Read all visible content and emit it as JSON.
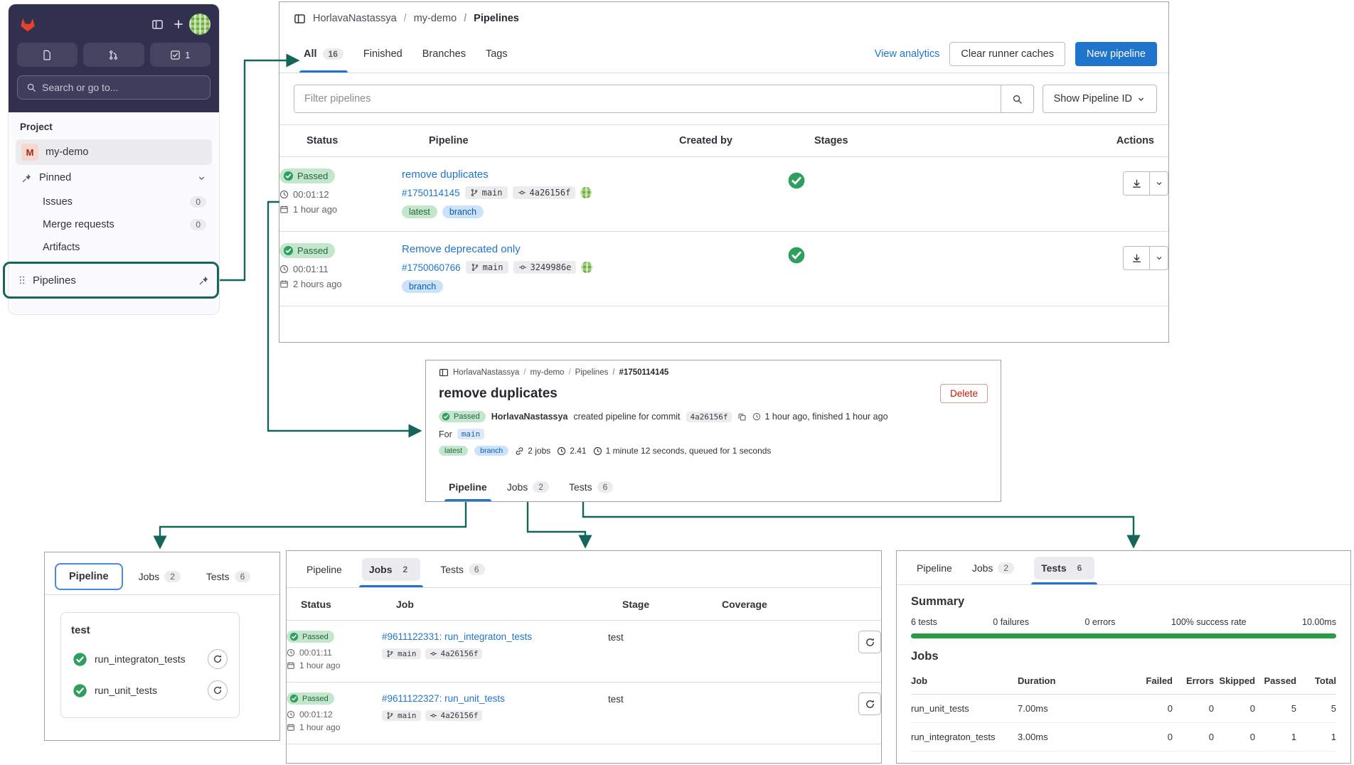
{
  "colors": {
    "accent_blue": "#1f75cb",
    "success_green": "#2f9e5e",
    "annotation_teal": "#14665a",
    "danger_red": "#c91c00"
  },
  "sidebar": {
    "todo_count": "1",
    "search_placeholder": "Search or go to...",
    "section_label": "Project",
    "project_initial": "M",
    "project_name": "my-demo",
    "pinned_label": "Pinned",
    "items": [
      {
        "label": "Issues",
        "count": "0"
      },
      {
        "label": "Merge requests",
        "count": "0"
      },
      {
        "label": "Artifacts"
      }
    ],
    "pipelines_label": "Pipelines"
  },
  "pipelines_panel": {
    "breadcrumb": {
      "group": "HorlavaNastassya",
      "project": "my-demo",
      "page": "Pipelines"
    },
    "tabs": [
      {
        "label": "All",
        "count": "16"
      },
      {
        "label": "Finished"
      },
      {
        "label": "Branches"
      },
      {
        "label": "Tags"
      }
    ],
    "view_analytics_label": "View analytics",
    "clear_caches_label": "Clear runner caches",
    "new_pipeline_label": "New pipeline",
    "filter_placeholder": "Filter pipelines",
    "show_pipeline_id_label": "Show Pipeline ID",
    "columns": {
      "status": "Status",
      "pipeline": "Pipeline",
      "created_by": "Created by",
      "stages": "Stages",
      "actions": "Actions"
    },
    "rows": [
      {
        "status": "Passed",
        "duration": "00:01:12",
        "age": "1 hour ago",
        "title": "remove duplicates",
        "id": "#1750114145",
        "branch": "main",
        "commit": "4a26156f",
        "tag1": "latest",
        "tag2": "branch"
      },
      {
        "status": "Passed",
        "duration": "00:01:11",
        "age": "2 hours ago",
        "title": "Remove deprecated only",
        "id": "#1750060766",
        "branch": "main",
        "commit": "3249986e",
        "tag1": "branch"
      }
    ]
  },
  "detail_panel": {
    "breadcrumb": {
      "group": "HorlavaNastassya",
      "project": "my-demo",
      "page": "Pipelines",
      "id": "#1750114145"
    },
    "title": "remove duplicates",
    "delete_label": "Delete",
    "status": "Passed",
    "user": "HorlavaNastassya",
    "action_text": "created pipeline for commit",
    "commit": "4a26156f",
    "time_text": "1 hour ago, finished 1 hour ago",
    "for_label": "For",
    "branch": "main",
    "tag1": "latest",
    "tag2": "branch",
    "jobs_label": "2 jobs",
    "compute": "2.41",
    "duration_text": "1 minute 12 seconds, queued for 1 seconds",
    "tabs": {
      "pipeline": "Pipeline",
      "jobs": "Jobs",
      "jobs_count": "2",
      "tests": "Tests",
      "tests_count": "6"
    }
  },
  "graph_panel": {
    "tabs": {
      "pipeline": "Pipeline",
      "jobs": "Jobs",
      "jobs_count": "2",
      "tests": "Tests",
      "tests_count": "6"
    },
    "stage_name": "test",
    "jobs": [
      {
        "name": "run_integraton_tests"
      },
      {
        "name": "run_unit_tests"
      }
    ]
  },
  "jobs_panel": {
    "tabs": {
      "pipeline": "Pipeline",
      "jobs": "Jobs",
      "jobs_count": "2",
      "tests": "Tests",
      "tests_count": "6"
    },
    "columns": {
      "status": "Status",
      "job": "Job",
      "stage": "Stage",
      "coverage": "Coverage"
    },
    "rows": [
      {
        "status": "Passed",
        "duration": "00:01:11",
        "age": "1 hour ago",
        "job": "#9611122331: run_integraton_tests",
        "branch": "main",
        "commit": "4a26156f",
        "stage": "test"
      },
      {
        "status": "Passed",
        "duration": "00:01:12",
        "age": "1 hour ago",
        "job": "#9611122327: run_unit_tests",
        "branch": "main",
        "commit": "4a26156f",
        "stage": "test"
      }
    ]
  },
  "tests_panel": {
    "tabs": {
      "pipeline": "Pipeline",
      "jobs": "Jobs",
      "jobs_count": "2",
      "tests": "Tests",
      "tests_count": "6"
    },
    "summary_title": "Summary",
    "stats": {
      "tests": "6 tests",
      "failures": "0 failures",
      "errors": "0 errors",
      "success": "100% success rate",
      "time": "10.00ms"
    },
    "jobs_title": "Jobs",
    "columns": {
      "job": "Job",
      "duration": "Duration",
      "failed": "Failed",
      "errors": "Errors",
      "skipped": "Skipped",
      "passed": "Passed",
      "total": "Total"
    },
    "rows": [
      {
        "job": "run_unit_tests",
        "duration": "7.00ms",
        "failed": "0",
        "errors": "0",
        "skipped": "0",
        "passed": "5",
        "total": "5"
      },
      {
        "job": "run_integraton_tests",
        "duration": "3.00ms",
        "failed": "0",
        "errors": "0",
        "skipped": "0",
        "passed": "1",
        "total": "1"
      }
    ]
  }
}
